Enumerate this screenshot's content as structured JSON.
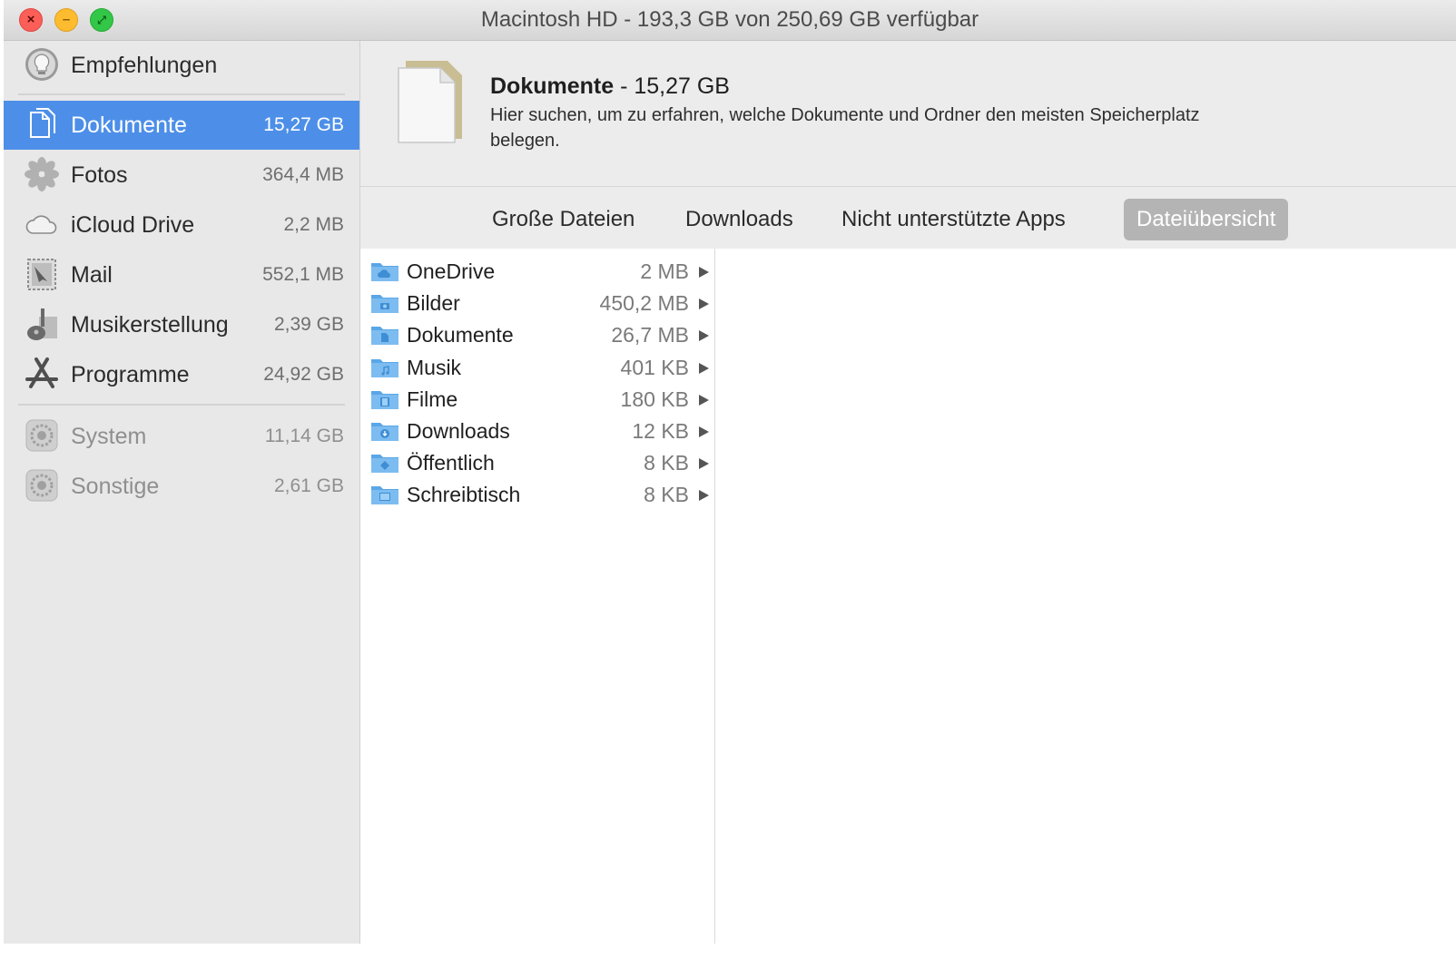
{
  "window": {
    "title": "Macintosh HD - 193,3 GB von 250,69 GB verfügbar"
  },
  "sidebar": {
    "recommendations": {
      "label": "Empfehlungen"
    },
    "items": [
      {
        "label": "Dokumente",
        "size": "15,27 GB",
        "icon": "documents-icon",
        "selected": true
      },
      {
        "label": "Fotos",
        "size": "364,4 MB",
        "icon": "photos-icon"
      },
      {
        "label": "iCloud Drive",
        "size": "2,2 MB",
        "icon": "cloud-icon"
      },
      {
        "label": "Mail",
        "size": "552,1 MB",
        "icon": "mail-stamp-icon"
      },
      {
        "label": "Musikerstellung",
        "size": "2,39 GB",
        "icon": "guitar-icon"
      },
      {
        "label": "Programme",
        "size": "24,92 GB",
        "icon": "app-store-icon"
      }
    ],
    "system_items": [
      {
        "label": "System",
        "size": "11,14 GB",
        "icon": "gear-icon"
      },
      {
        "label": "Sonstige",
        "size": "2,61 GB",
        "icon": "gear-icon"
      }
    ]
  },
  "header": {
    "title": "Dokumente",
    "title_separator": " - ",
    "size": "15,27 GB",
    "description": "Hier suchen, um zu erfahren, welche Dokumente und Ordner den meisten Speicherplatz belegen."
  },
  "tabs": [
    {
      "label": "Große Dateien",
      "active": false
    },
    {
      "label": "Downloads",
      "active": false
    },
    {
      "label": "Nicht unterstützte Apps",
      "active": false
    },
    {
      "label": "Dateiübersicht",
      "active": true
    }
  ],
  "folders": [
    {
      "name": "OneDrive",
      "size": "2 MB",
      "icon": "cloud-folder-icon"
    },
    {
      "name": "Bilder",
      "size": "450,2 MB",
      "icon": "pictures-folder-icon"
    },
    {
      "name": "Dokumente",
      "size": "26,7 MB",
      "icon": "documents-folder-icon"
    },
    {
      "name": "Musik",
      "size": "401 KB",
      "icon": "music-folder-icon"
    },
    {
      "name": "Filme",
      "size": "180 KB",
      "icon": "movies-folder-icon"
    },
    {
      "name": "Downloads",
      "size": "12 KB",
      "icon": "downloads-folder-icon"
    },
    {
      "name": "Öffentlich",
      "size": "8 KB",
      "icon": "public-folder-icon"
    },
    {
      "name": "Schreibtisch",
      "size": "8 KB",
      "icon": "desktop-folder-icon"
    }
  ],
  "colors": {
    "selection": "#4d8fe8",
    "active_tab": "#b4b4b4",
    "folder": "#6cb3ec"
  }
}
